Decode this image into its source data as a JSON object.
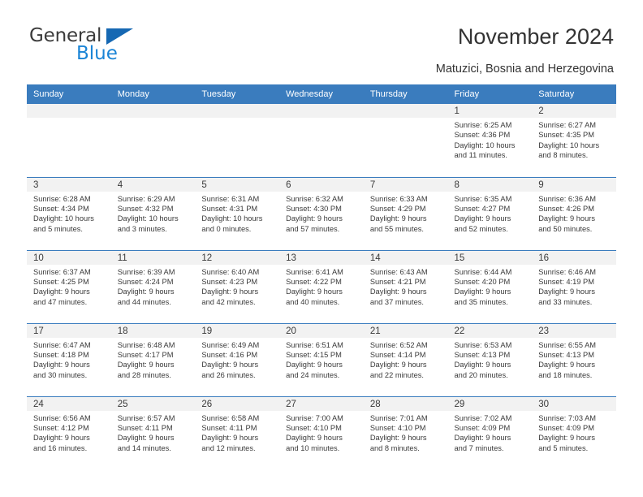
{
  "brand": {
    "name_part1": "General",
    "name_part2": "Blue",
    "accent_color": "#1668b3",
    "flag_icon": "triangle-flag-icon"
  },
  "header": {
    "title": "November 2024",
    "subtitle": "Matuzici, Bosnia and Herzegovina"
  },
  "calendar": {
    "header_bg": "#3a7cbe",
    "daynum_bg": "#f2f2f2",
    "weekdays": [
      "Sunday",
      "Monday",
      "Tuesday",
      "Wednesday",
      "Thursday",
      "Friday",
      "Saturday"
    ],
    "weeks": [
      [
        {
          "day": "",
          "sunrise": "",
          "sunset": "",
          "daylight": "",
          "daylight2": ""
        },
        {
          "day": "",
          "sunrise": "",
          "sunset": "",
          "daylight": "",
          "daylight2": ""
        },
        {
          "day": "",
          "sunrise": "",
          "sunset": "",
          "daylight": "",
          "daylight2": ""
        },
        {
          "day": "",
          "sunrise": "",
          "sunset": "",
          "daylight": "",
          "daylight2": ""
        },
        {
          "day": "",
          "sunrise": "",
          "sunset": "",
          "daylight": "",
          "daylight2": ""
        },
        {
          "day": "1",
          "sunrise": "Sunrise: 6:25 AM",
          "sunset": "Sunset: 4:36 PM",
          "daylight": "Daylight: 10 hours",
          "daylight2": "and 11 minutes."
        },
        {
          "day": "2",
          "sunrise": "Sunrise: 6:27 AM",
          "sunset": "Sunset: 4:35 PM",
          "daylight": "Daylight: 10 hours",
          "daylight2": "and 8 minutes."
        }
      ],
      [
        {
          "day": "3",
          "sunrise": "Sunrise: 6:28 AM",
          "sunset": "Sunset: 4:34 PM",
          "daylight": "Daylight: 10 hours",
          "daylight2": "and 5 minutes."
        },
        {
          "day": "4",
          "sunrise": "Sunrise: 6:29 AM",
          "sunset": "Sunset: 4:32 PM",
          "daylight": "Daylight: 10 hours",
          "daylight2": "and 3 minutes."
        },
        {
          "day": "5",
          "sunrise": "Sunrise: 6:31 AM",
          "sunset": "Sunset: 4:31 PM",
          "daylight": "Daylight: 10 hours",
          "daylight2": "and 0 minutes."
        },
        {
          "day": "6",
          "sunrise": "Sunrise: 6:32 AM",
          "sunset": "Sunset: 4:30 PM",
          "daylight": "Daylight: 9 hours",
          "daylight2": "and 57 minutes."
        },
        {
          "day": "7",
          "sunrise": "Sunrise: 6:33 AM",
          "sunset": "Sunset: 4:29 PM",
          "daylight": "Daylight: 9 hours",
          "daylight2": "and 55 minutes."
        },
        {
          "day": "8",
          "sunrise": "Sunrise: 6:35 AM",
          "sunset": "Sunset: 4:27 PM",
          "daylight": "Daylight: 9 hours",
          "daylight2": "and 52 minutes."
        },
        {
          "day": "9",
          "sunrise": "Sunrise: 6:36 AM",
          "sunset": "Sunset: 4:26 PM",
          "daylight": "Daylight: 9 hours",
          "daylight2": "and 50 minutes."
        }
      ],
      [
        {
          "day": "10",
          "sunrise": "Sunrise: 6:37 AM",
          "sunset": "Sunset: 4:25 PM",
          "daylight": "Daylight: 9 hours",
          "daylight2": "and 47 minutes."
        },
        {
          "day": "11",
          "sunrise": "Sunrise: 6:39 AM",
          "sunset": "Sunset: 4:24 PM",
          "daylight": "Daylight: 9 hours",
          "daylight2": "and 44 minutes."
        },
        {
          "day": "12",
          "sunrise": "Sunrise: 6:40 AM",
          "sunset": "Sunset: 4:23 PM",
          "daylight": "Daylight: 9 hours",
          "daylight2": "and 42 minutes."
        },
        {
          "day": "13",
          "sunrise": "Sunrise: 6:41 AM",
          "sunset": "Sunset: 4:22 PM",
          "daylight": "Daylight: 9 hours",
          "daylight2": "and 40 minutes."
        },
        {
          "day": "14",
          "sunrise": "Sunrise: 6:43 AM",
          "sunset": "Sunset: 4:21 PM",
          "daylight": "Daylight: 9 hours",
          "daylight2": "and 37 minutes."
        },
        {
          "day": "15",
          "sunrise": "Sunrise: 6:44 AM",
          "sunset": "Sunset: 4:20 PM",
          "daylight": "Daylight: 9 hours",
          "daylight2": "and 35 minutes."
        },
        {
          "day": "16",
          "sunrise": "Sunrise: 6:46 AM",
          "sunset": "Sunset: 4:19 PM",
          "daylight": "Daylight: 9 hours",
          "daylight2": "and 33 minutes."
        }
      ],
      [
        {
          "day": "17",
          "sunrise": "Sunrise: 6:47 AM",
          "sunset": "Sunset: 4:18 PM",
          "daylight": "Daylight: 9 hours",
          "daylight2": "and 30 minutes."
        },
        {
          "day": "18",
          "sunrise": "Sunrise: 6:48 AM",
          "sunset": "Sunset: 4:17 PM",
          "daylight": "Daylight: 9 hours",
          "daylight2": "and 28 minutes."
        },
        {
          "day": "19",
          "sunrise": "Sunrise: 6:49 AM",
          "sunset": "Sunset: 4:16 PM",
          "daylight": "Daylight: 9 hours",
          "daylight2": "and 26 minutes."
        },
        {
          "day": "20",
          "sunrise": "Sunrise: 6:51 AM",
          "sunset": "Sunset: 4:15 PM",
          "daylight": "Daylight: 9 hours",
          "daylight2": "and 24 minutes."
        },
        {
          "day": "21",
          "sunrise": "Sunrise: 6:52 AM",
          "sunset": "Sunset: 4:14 PM",
          "daylight": "Daylight: 9 hours",
          "daylight2": "and 22 minutes."
        },
        {
          "day": "22",
          "sunrise": "Sunrise: 6:53 AM",
          "sunset": "Sunset: 4:13 PM",
          "daylight": "Daylight: 9 hours",
          "daylight2": "and 20 minutes."
        },
        {
          "day": "23",
          "sunrise": "Sunrise: 6:55 AM",
          "sunset": "Sunset: 4:13 PM",
          "daylight": "Daylight: 9 hours",
          "daylight2": "and 18 minutes."
        }
      ],
      [
        {
          "day": "24",
          "sunrise": "Sunrise: 6:56 AM",
          "sunset": "Sunset: 4:12 PM",
          "daylight": "Daylight: 9 hours",
          "daylight2": "and 16 minutes."
        },
        {
          "day": "25",
          "sunrise": "Sunrise: 6:57 AM",
          "sunset": "Sunset: 4:11 PM",
          "daylight": "Daylight: 9 hours",
          "daylight2": "and 14 minutes."
        },
        {
          "day": "26",
          "sunrise": "Sunrise: 6:58 AM",
          "sunset": "Sunset: 4:11 PM",
          "daylight": "Daylight: 9 hours",
          "daylight2": "and 12 minutes."
        },
        {
          "day": "27",
          "sunrise": "Sunrise: 7:00 AM",
          "sunset": "Sunset: 4:10 PM",
          "daylight": "Daylight: 9 hours",
          "daylight2": "and 10 minutes."
        },
        {
          "day": "28",
          "sunrise": "Sunrise: 7:01 AM",
          "sunset": "Sunset: 4:10 PM",
          "daylight": "Daylight: 9 hours",
          "daylight2": "and 8 minutes."
        },
        {
          "day": "29",
          "sunrise": "Sunrise: 7:02 AM",
          "sunset": "Sunset: 4:09 PM",
          "daylight": "Daylight: 9 hours",
          "daylight2": "and 7 minutes."
        },
        {
          "day": "30",
          "sunrise": "Sunrise: 7:03 AM",
          "sunset": "Sunset: 4:09 PM",
          "daylight": "Daylight: 9 hours",
          "daylight2": "and 5 minutes."
        }
      ]
    ]
  }
}
